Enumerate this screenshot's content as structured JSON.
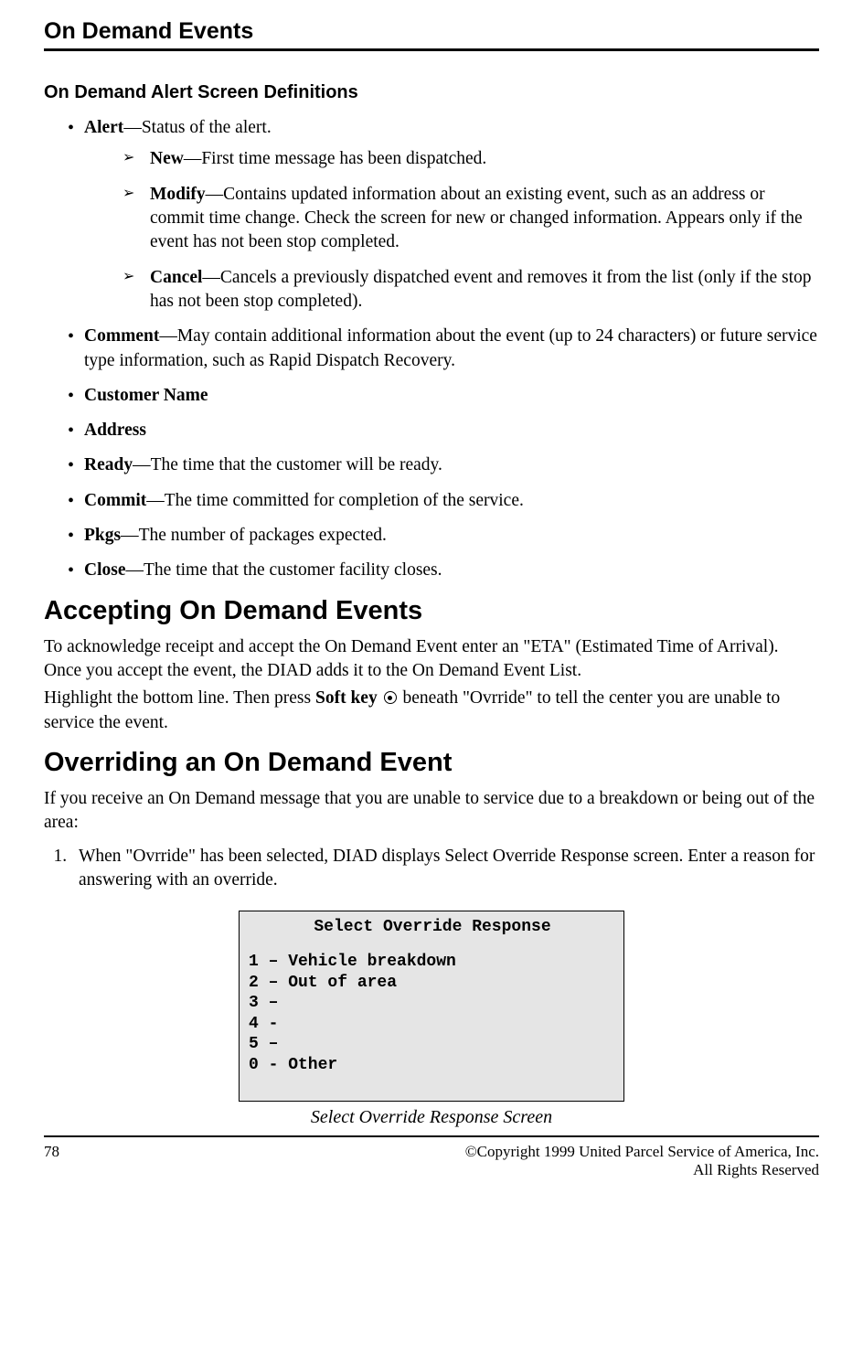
{
  "header": {
    "title": "On Demand Events"
  },
  "section1": {
    "heading": "On Demand Alert Screen Definitions",
    "bullets": {
      "alert": {
        "label": "Alert",
        "text": "—Status of the alert."
      },
      "alert_sub": {
        "new": {
          "label": "New",
          "text": "—First time message has been dispatched."
        },
        "modify": {
          "label": "Modify",
          "text": "—Contains updated information about an existing event, such as an address or commit time change. Check the screen for new or changed information. Appears only if the event has not been stop completed."
        },
        "cancel": {
          "label": "Cancel",
          "text": "—Cancels a previously dispatched event and removes it from the list (only if the stop has not been stop completed)."
        }
      },
      "comment": {
        "label": "Comment",
        "text": "—May contain additional information about the event (up to 24 characters) or future service type information, such as Rapid Dispatch Recovery."
      },
      "customer_name": {
        "label": "Customer Name"
      },
      "address": {
        "label": "Address"
      },
      "ready": {
        "label": "Ready",
        "text": "—The time that the customer will be ready."
      },
      "commit": {
        "label": "Commit",
        "text": "—The time committed for completion of the service."
      },
      "pkgs": {
        "label": "Pkgs",
        "text": "—The number of packages expected."
      },
      "close": {
        "label": "Close",
        "text": "—The time that the customer facility closes."
      }
    }
  },
  "section2": {
    "heading": "Accepting On Demand Events",
    "p1": "To acknowledge receipt and accept the On Demand Event enter an \"ETA\" (Estimated Time of Arrival). Once you accept the event, the DIAD adds it to the On Demand Event List.",
    "p2a": "Highlight the bottom line. Then press ",
    "p2b": "Soft key ",
    "p2c": " beneath \"Ovrride\" to tell the center you are unable to service the event."
  },
  "section3": {
    "heading": "Overriding an On Demand Event",
    "intro": "If you receive an On Demand message that you are unable to service due to a breakdown or being out of the area:",
    "step1": "When \"Ovrride\" has been selected, DIAD displays Select Override Response screen. Enter a reason for answering with an override."
  },
  "screen": {
    "title": "Select Override Response",
    "lines": [
      "1 – Vehicle breakdown",
      "2 – Out of area",
      "3 –",
      "4 -",
      "5 –",
      "0 - Other"
    ],
    "caption": "Select Override Response Screen"
  },
  "footer": {
    "page": "78",
    "copyright": "©Copyright 1999 United Parcel Service of America, Inc.",
    "rights": "All Rights Reserved"
  }
}
